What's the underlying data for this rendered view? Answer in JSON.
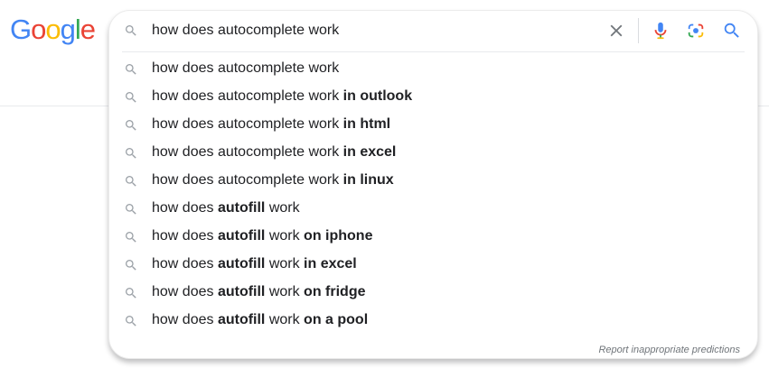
{
  "logo": {
    "letters": [
      {
        "char": "G",
        "color": "#4285F4"
      },
      {
        "char": "o",
        "color": "#EA4335"
      },
      {
        "char": "o",
        "color": "#FBBC05"
      },
      {
        "char": "g",
        "color": "#4285F4"
      },
      {
        "char": "l",
        "color": "#34A853"
      },
      {
        "char": "e",
        "color": "#EA4335"
      }
    ]
  },
  "search": {
    "query": "how does autocomplete work",
    "icons": {
      "leading": "search-icon",
      "clear": "close-icon",
      "voice": "microphone-icon",
      "image": "camera-lens-icon",
      "submit": "search-icon"
    },
    "colors": {
      "blue": "#4285F4",
      "red": "#EA4335",
      "yellow": "#FBBC05",
      "green": "#34A853",
      "icon_gray": "#9aa0a6"
    }
  },
  "suggestions": [
    {
      "parts": [
        {
          "text": "how does autocomplete work",
          "bold": false
        }
      ]
    },
    {
      "parts": [
        {
          "text": "how does autocomplete work ",
          "bold": false
        },
        {
          "text": "in outlook",
          "bold": true
        }
      ]
    },
    {
      "parts": [
        {
          "text": "how does autocomplete work ",
          "bold": false
        },
        {
          "text": "in html",
          "bold": true
        }
      ]
    },
    {
      "parts": [
        {
          "text": "how does autocomplete work ",
          "bold": false
        },
        {
          "text": "in excel",
          "bold": true
        }
      ]
    },
    {
      "parts": [
        {
          "text": "how does autocomplete work ",
          "bold": false
        },
        {
          "text": "in linux",
          "bold": true
        }
      ]
    },
    {
      "parts": [
        {
          "text": "how does ",
          "bold": false
        },
        {
          "text": "autofill",
          "bold": true
        },
        {
          "text": " work",
          "bold": false
        }
      ]
    },
    {
      "parts": [
        {
          "text": "how does ",
          "bold": false
        },
        {
          "text": "autofill",
          "bold": true
        },
        {
          "text": " work ",
          "bold": false
        },
        {
          "text": "on iphone",
          "bold": true
        }
      ]
    },
    {
      "parts": [
        {
          "text": "how does ",
          "bold": false
        },
        {
          "text": "autofill",
          "bold": true
        },
        {
          "text": " work ",
          "bold": false
        },
        {
          "text": "in excel",
          "bold": true
        }
      ]
    },
    {
      "parts": [
        {
          "text": "how does ",
          "bold": false
        },
        {
          "text": "autofill",
          "bold": true
        },
        {
          "text": " work ",
          "bold": false
        },
        {
          "text": "on fridge",
          "bold": true
        }
      ]
    },
    {
      "parts": [
        {
          "text": "how does ",
          "bold": false
        },
        {
          "text": "autofill",
          "bold": true
        },
        {
          "text": " work ",
          "bold": false
        },
        {
          "text": "on a pool",
          "bold": true
        }
      ]
    }
  ],
  "footer": {
    "report_label": "Report inappropriate predictions"
  }
}
